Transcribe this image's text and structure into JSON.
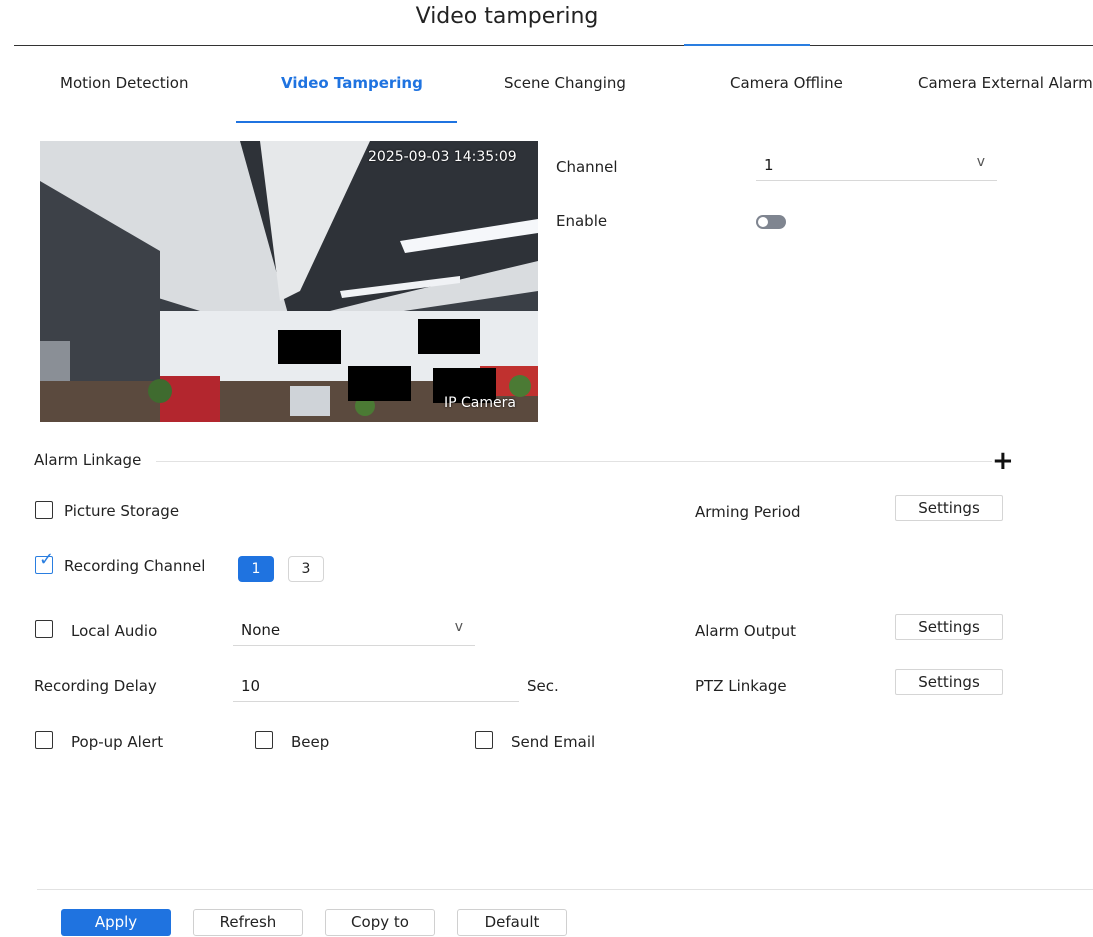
{
  "page": {
    "title": "Video tampering"
  },
  "tabs": [
    {
      "label": "Motion Detection",
      "active": false
    },
    {
      "label": "Video Tampering",
      "active": true
    },
    {
      "label": "Scene Changing",
      "active": false
    },
    {
      "label": "Camera Offline",
      "active": false
    },
    {
      "label": "Camera External Alarm",
      "active": false
    }
  ],
  "preview": {
    "timestamp": "2025-09-03 14:35:09",
    "camera_name": "IP Camera"
  },
  "channel": {
    "label": "Channel",
    "value": "1",
    "chevron": "v"
  },
  "enable": {
    "label": "Enable",
    "on": false
  },
  "alarm_linkage": {
    "title": "Alarm Linkage",
    "add_icon": "+",
    "picture_storage": {
      "label": "Picture Storage",
      "checked": false
    },
    "recording_channel": {
      "label": "Recording Channel",
      "checked": true,
      "channels": [
        "1",
        "3"
      ],
      "selected": "1"
    },
    "local_audio": {
      "label": "Local Audio",
      "checked": false,
      "value": "None",
      "chevron": "v"
    },
    "recording_delay": {
      "label": "Recording Delay",
      "value": "10",
      "unit": "Sec."
    },
    "popup_alert": {
      "label": "Pop-up Alert",
      "checked": false
    },
    "beep": {
      "label": "Beep",
      "checked": false
    },
    "send_email": {
      "label": "Send Email",
      "checked": false
    },
    "arming_period": {
      "label": "Arming Period",
      "button": "Settings"
    },
    "alarm_output": {
      "label": "Alarm Output",
      "button": "Settings"
    },
    "ptz_linkage": {
      "label": "PTZ Linkage",
      "button": "Settings"
    }
  },
  "footer": {
    "apply": "Apply",
    "refresh": "Refresh",
    "copy_to": "Copy to",
    "default": "Default"
  },
  "colors": {
    "accent": "#1f73e0",
    "toggle_off": "#7f8590",
    "divider": "#e2e2e2"
  }
}
